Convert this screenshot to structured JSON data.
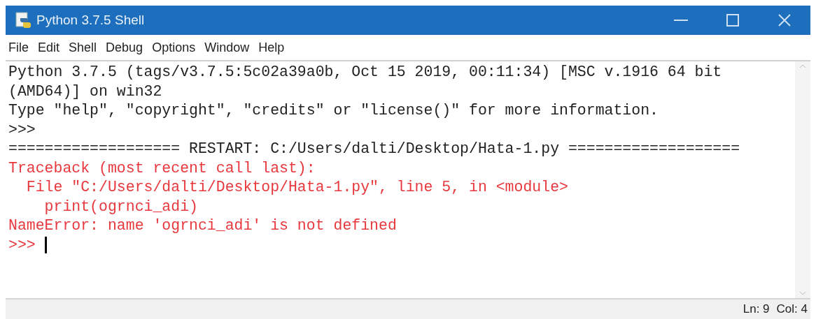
{
  "window": {
    "title": "Python 3.7.5 Shell"
  },
  "menu": [
    "File",
    "Edit",
    "Shell",
    "Debug",
    "Options",
    "Window",
    "Help"
  ],
  "lines": [
    {
      "kind": "output",
      "text": "Python 3.7.5 (tags/v3.7.5:5c02a39a0b, Oct 15 2019, 00:11:34) [MSC v.1916 64 bit",
      "cursor": false
    },
    {
      "kind": "output",
      "text": "(AMD64)] on win32",
      "cursor": false
    },
    {
      "kind": "output",
      "text": "Type \"help\", \"copyright\", \"credits\" or \"license()\" for more information.",
      "cursor": false
    },
    {
      "kind": "output",
      "text": ">>>",
      "cursor": false
    },
    {
      "kind": "output",
      "text": "=================== RESTART: C:/Users/dalti/Desktop/Hata-1.py ===================",
      "cursor": false
    },
    {
      "kind": "error",
      "text": "Traceback (most recent call last):",
      "cursor": false
    },
    {
      "kind": "error",
      "text": "  File \"C:/Users/dalti/Desktop/Hata-1.py\", line 5, in <module>",
      "cursor": false
    },
    {
      "kind": "error",
      "text": "    print(ogrnci_adi)",
      "cursor": false
    },
    {
      "kind": "error",
      "text": "NameError: name 'ogrnci_adi' is not defined",
      "cursor": false
    },
    {
      "kind": "error",
      "text": ">>> ",
      "cursor": true
    }
  ],
  "status_bar": [
    "Ln: 9",
    "Col: 4"
  ]
}
